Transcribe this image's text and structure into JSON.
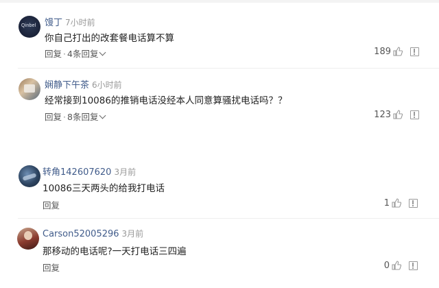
{
  "comments": [
    {
      "avatar_text": "Qinbel",
      "name": "馒丁",
      "time": "7小时前",
      "text": "你自己打出的改套餐电话算不算",
      "reply_label": "回复",
      "replies_label": "4条回复",
      "likes": "189"
    },
    {
      "name": "娴静下午茶",
      "time": "6小时前",
      "text": "经常接到10086的推销电话没经本人同意算骚扰电话吗？？",
      "reply_label": "回复",
      "replies_label": "8条回复",
      "likes": "123"
    },
    {
      "name": "转角142607620",
      "time": "3月前",
      "text": "10086三天两头的给我打电话",
      "reply_label": "回复",
      "likes": "1"
    },
    {
      "name": "Carson52005296",
      "time": "3月前",
      "text": "那移动的电话呢?一天打电话三四遍",
      "reply_label": "回复",
      "likes": "0"
    }
  ],
  "separator_dot": "·"
}
